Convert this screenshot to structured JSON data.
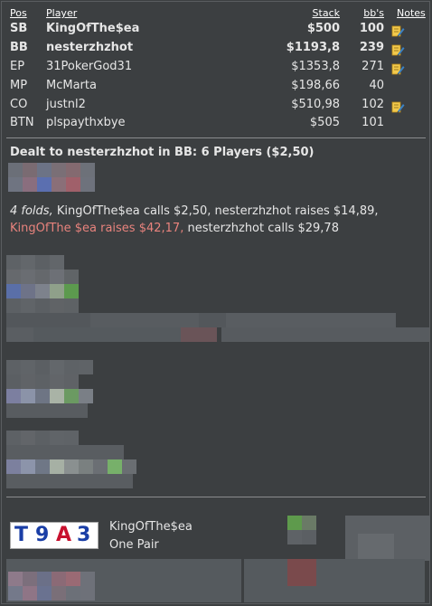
{
  "header": {
    "pos": "Pos",
    "player": "Player",
    "stack": "Stack",
    "bbs": "bb's",
    "notes": "Notes"
  },
  "players": [
    {
      "pos": "SB",
      "name": "KingOfThe$ea",
      "stack": "$500",
      "bbs": "100",
      "bold": true,
      "note": true
    },
    {
      "pos": "BB",
      "name": "nesterzhzhot",
      "stack": "$1193,8",
      "bbs": "239",
      "bold": true,
      "note": true
    },
    {
      "pos": "EP",
      "name": "31PokerGod31",
      "stack": "$1353,8",
      "bbs": "271",
      "bold": false,
      "note": true
    },
    {
      "pos": "MP",
      "name": "McMarta",
      "stack": "$198,66",
      "bbs": "40",
      "bold": false,
      "note": false
    },
    {
      "pos": "CO",
      "name": "justnl2",
      "stack": "$510,98",
      "bbs": "102",
      "bold": false,
      "note": true
    },
    {
      "pos": "BTN",
      "name": "plspaythxbye",
      "stack": "$505",
      "bbs": "101",
      "bold": false,
      "note": false
    }
  ],
  "dealt": "Dealt to nesterzhzhot in BB: 6 Players ($2,50)",
  "preflop": {
    "folds": "4 folds,",
    "part1": " KingOfThe$ea calls $2,50, nesterzhzhot raises $14,89, ",
    "highlight": "KingOfThe $ea raises $42,17,",
    "part2": " nesterzhzhot calls $29,78"
  },
  "logo": {
    "chars": [
      "T",
      "9",
      "A",
      "3"
    ],
    "colors": [
      "#1a3ea6",
      "#1a3ea6",
      "#c8102e",
      "#1a3ea6"
    ]
  },
  "result": {
    "name": "KingOfThe$ea",
    "hand": "One Pair"
  },
  "colors": {
    "background": "#3c3f41",
    "text": "#e6e6e6",
    "highlight": "#e8837d",
    "separator": "#8a8c8e"
  },
  "icons": {
    "note": "note-pencil-icon"
  }
}
